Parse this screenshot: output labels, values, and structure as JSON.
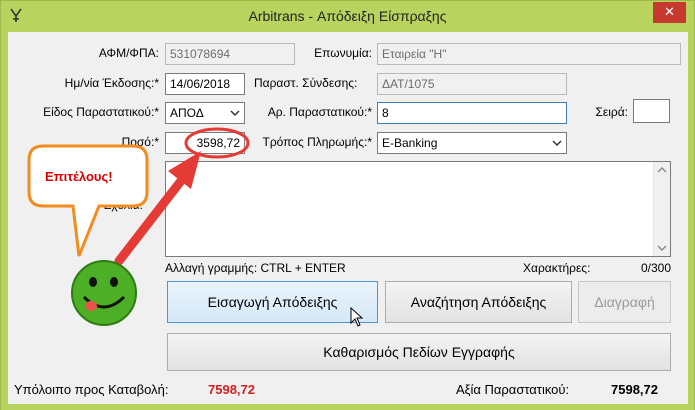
{
  "window": {
    "title": "Arbitrans - Απόδειξη Είσπραξης",
    "close_label": "✕",
    "frame_color": "#b9d35f"
  },
  "form": {
    "afm_label": "ΑΦΜ/ΦΠΑ:",
    "afm_value": "531078694",
    "eponymia_label": "Επωνυμία:",
    "eponymia_value": "Εταιρεία \"Η\"",
    "issue_date_label": "Ημ/νία Έκδοσης:*",
    "issue_date_value": "14/06/2018",
    "connection_label": "Παραστ. Σύνδεσης:",
    "connection_value": "ΔΑΤ/1075",
    "doc_type_label": "Είδος Παραστατικού:*",
    "doc_type_value": "ΑΠΟΔ",
    "doc_number_label": "Αρ. Παραστατικού:*",
    "doc_number_value": "8",
    "series_label": "Σειρά:",
    "series_value": "",
    "amount_label": "Ποσό:*",
    "amount_value": "3598,72",
    "payment_label": "Τρόπος Πληρωμής:*",
    "payment_value": "E-Banking",
    "comments_label": "Σχόλια:",
    "comments_value": "",
    "newline_hint": "Αλλαγή γραμμής: CTRL + ENTER",
    "chars_label": "Χαρακτήρες:",
    "chars_count": "0/300"
  },
  "buttons": {
    "insert": "Εισαγωγή Απόδειξης",
    "search": "Αναζήτηση Απόδειξης",
    "delete": "Διαγραφή",
    "clear": "Καθαρισμός Πεδίων Εγγραφής"
  },
  "annotation": {
    "callout_text": "Επιτέλους!",
    "accent_color": "#e53b36",
    "smiley_color": "#4caf26"
  },
  "footer": {
    "balance_label": "Υπόλοιπο προς Καταβολή:",
    "balance_value": "7598,72",
    "doc_value_label": "Αξία Παραστατικού:",
    "doc_value": "7598,72"
  }
}
